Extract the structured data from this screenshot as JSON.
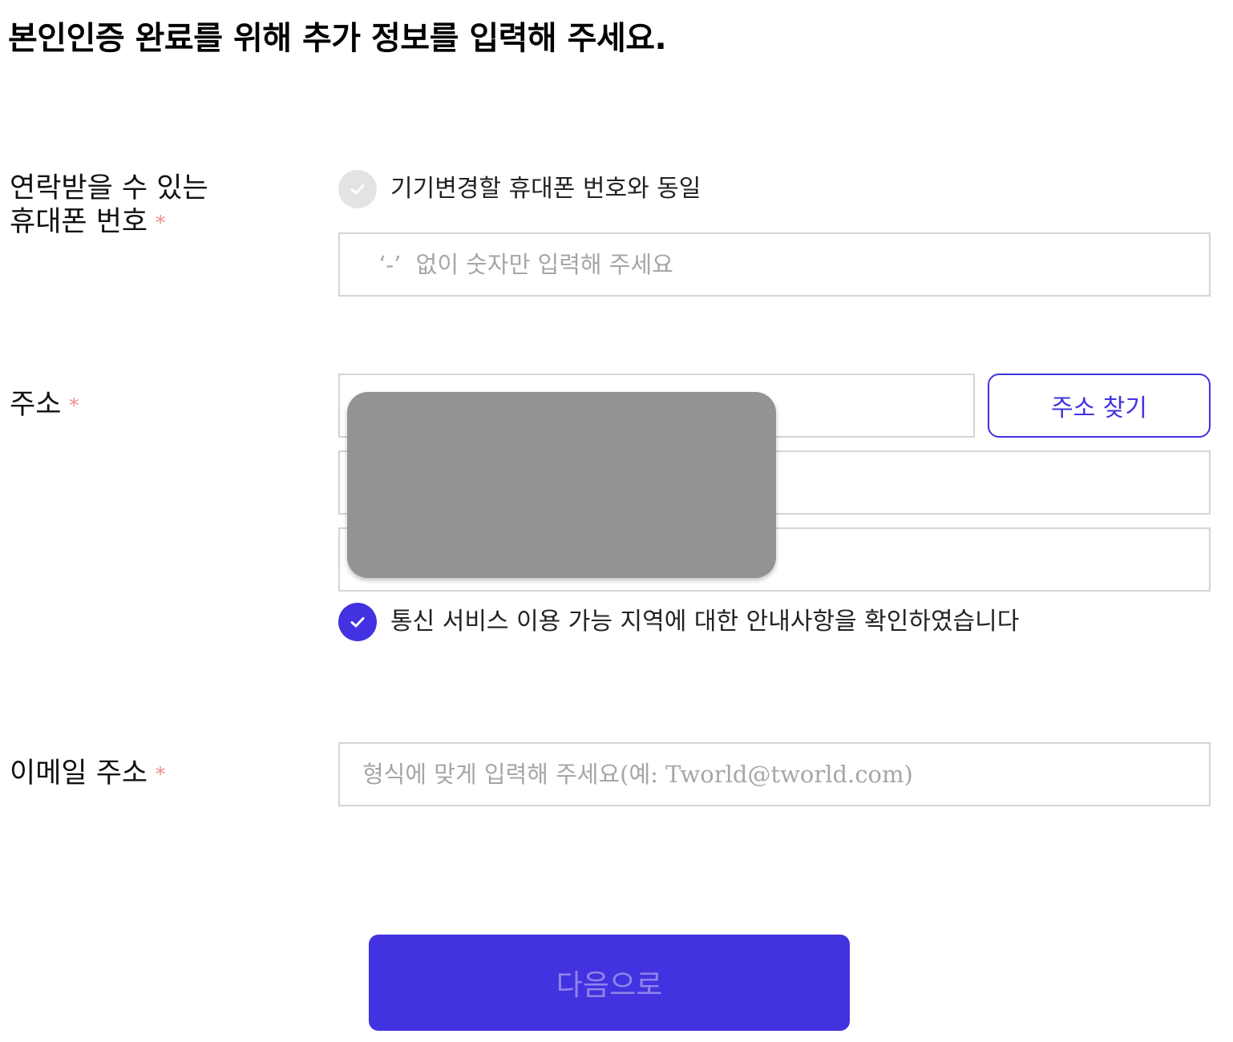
{
  "header": {
    "title": "본인인증 완료를 위해 추가 정보를 입력해 주세요."
  },
  "phone": {
    "label_line1": "연락받을 수 있는",
    "label_line2": "휴대폰 번호",
    "required_mark": "*",
    "same_checkbox_label": "기기변경할 휴대폰 번호와 동일",
    "same_checkbox_checked": false,
    "input_value": "",
    "input_placeholder": "‘-’  없이 숫자만 입력해 주세요"
  },
  "address": {
    "label": "주소",
    "required_mark": "*",
    "find_button_label": "주소 찾기",
    "line1_value": "",
    "line2_value": "",
    "line3_value": "",
    "consent_label": "통신 서비스 이용 가능 지역에 대한 안내사항을 확인하였습니다",
    "consent_checked": true
  },
  "email": {
    "label": "이메일 주소",
    "required_mark": "*",
    "input_value": "",
    "input_placeholder": "형식에 맞게 입력해 주세요(예: Tworld@tworld.com)"
  },
  "footer": {
    "next_button_label": "다음으로",
    "next_button_enabled": false
  },
  "colors": {
    "accent": "#4232df",
    "required": "#f08c8c",
    "input_border": "#d4d4d4",
    "placeholder": "#a6a6a6",
    "checkbox_off": "#e3e3e3",
    "redaction": "#939393"
  },
  "icons": {
    "checkbox_check": "check-icon"
  }
}
